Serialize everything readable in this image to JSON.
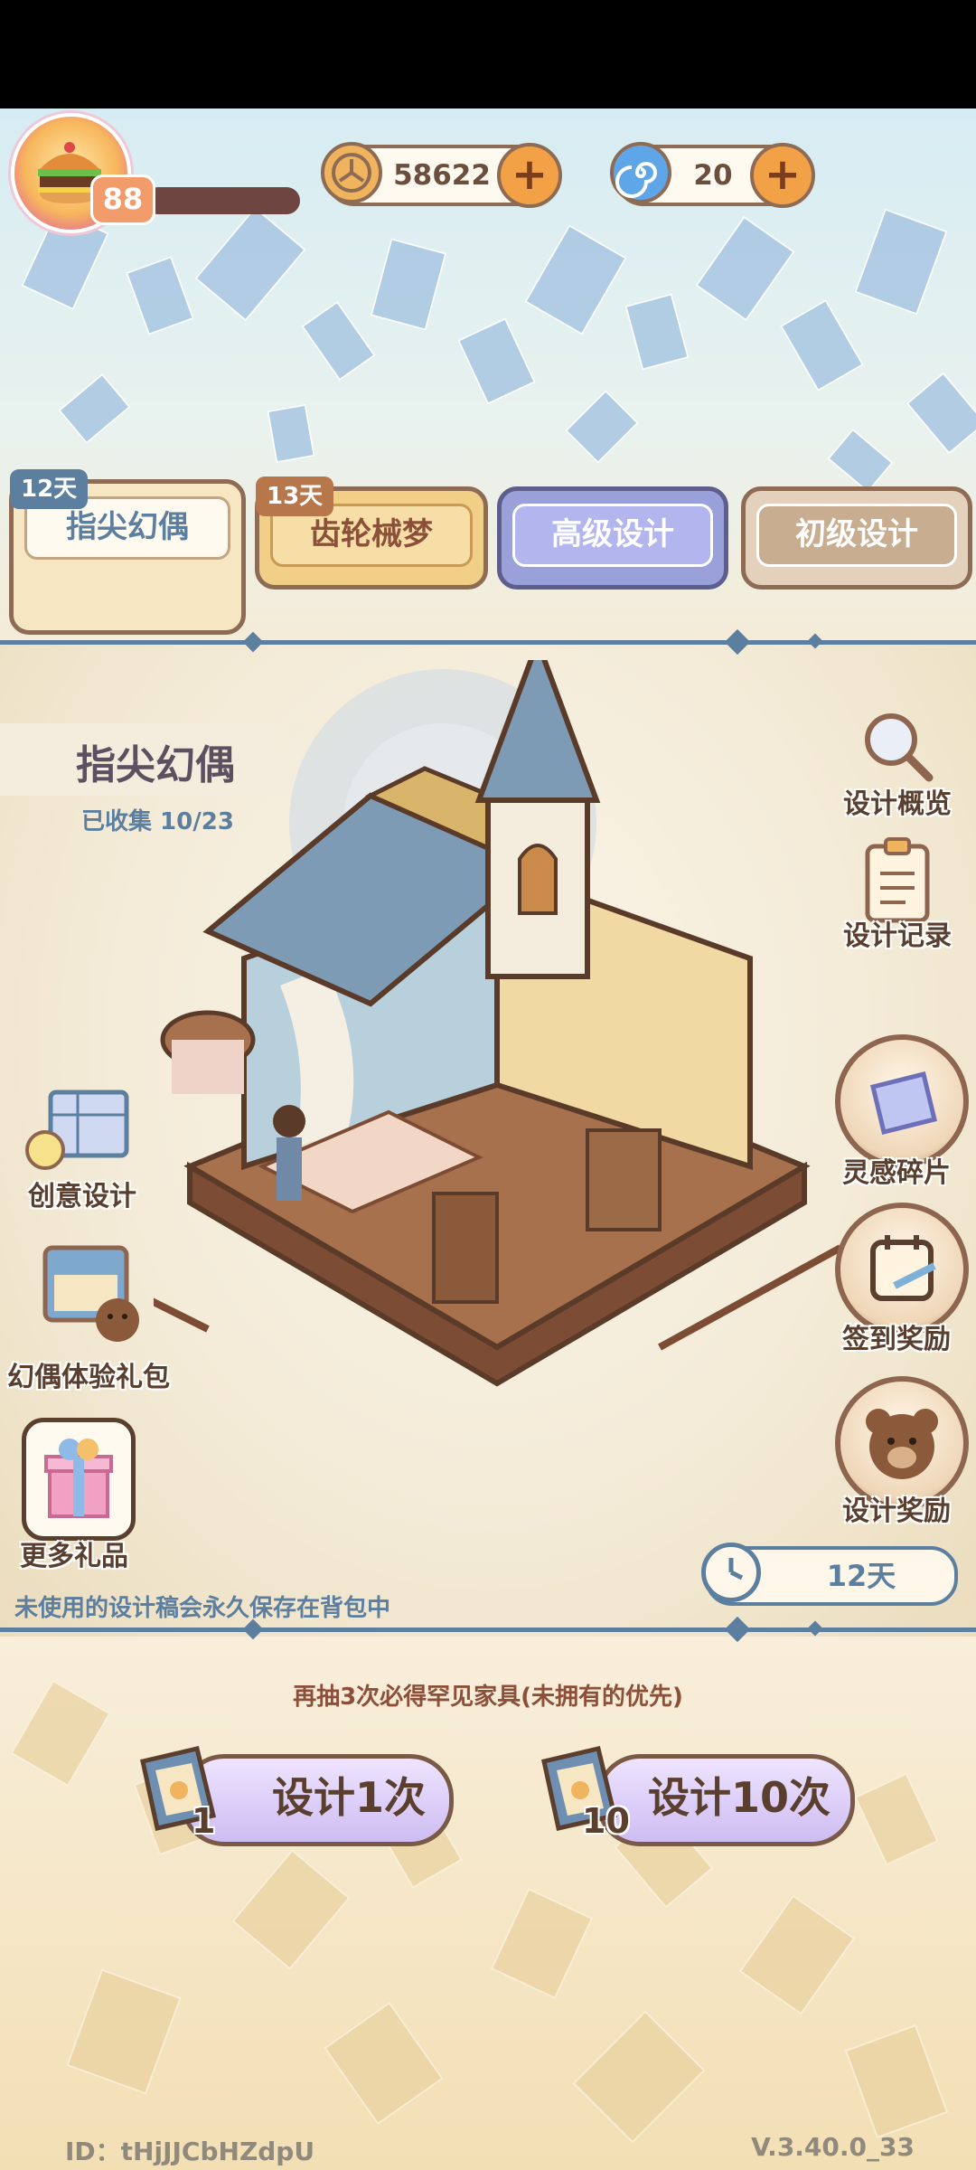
{
  "player": {
    "level": "88"
  },
  "currencies": [
    {
      "name": "coin",
      "value": "58622"
    },
    {
      "name": "spiral-gem",
      "value": "20"
    }
  ],
  "tabs": [
    {
      "label": "指尖幻偶",
      "badge": "12天",
      "selected": true
    },
    {
      "label": "齿轮械梦",
      "badge": "13天",
      "selected": false
    },
    {
      "label": "高级设计",
      "badge": "",
      "selected": false
    },
    {
      "label": "初级设计",
      "badge": "",
      "selected": false
    }
  ],
  "pool": {
    "title": "指尖幻偶",
    "collected": "已收集  10/23",
    "timer": "12天",
    "note": "未使用的设计稿会永久保存在背包中"
  },
  "right_menu": {
    "overview": "设计概览",
    "records": "设计记录",
    "fragments": "灵感碎片",
    "checkin": "签到奖励",
    "design_reward": "设计奖励"
  },
  "left_menu": {
    "creative": "创意设计",
    "gift_pack": "幻偶体验礼包",
    "more_gifts": "更多礼品"
  },
  "draw": {
    "hint": "再抽3次必得罕见家具(未拥有的优先)",
    "single_label": "设计1次",
    "single_count": "1",
    "ten_label": "设计10次",
    "ten_count": "10"
  },
  "footer": {
    "id": "ID：tHjJJCbHZdpU",
    "version": "V.3.40.0_33"
  },
  "colors": {
    "accent_blue": "#5c7fa0",
    "brown": "#8d6b55",
    "purple_tab": "#9aa0da"
  }
}
